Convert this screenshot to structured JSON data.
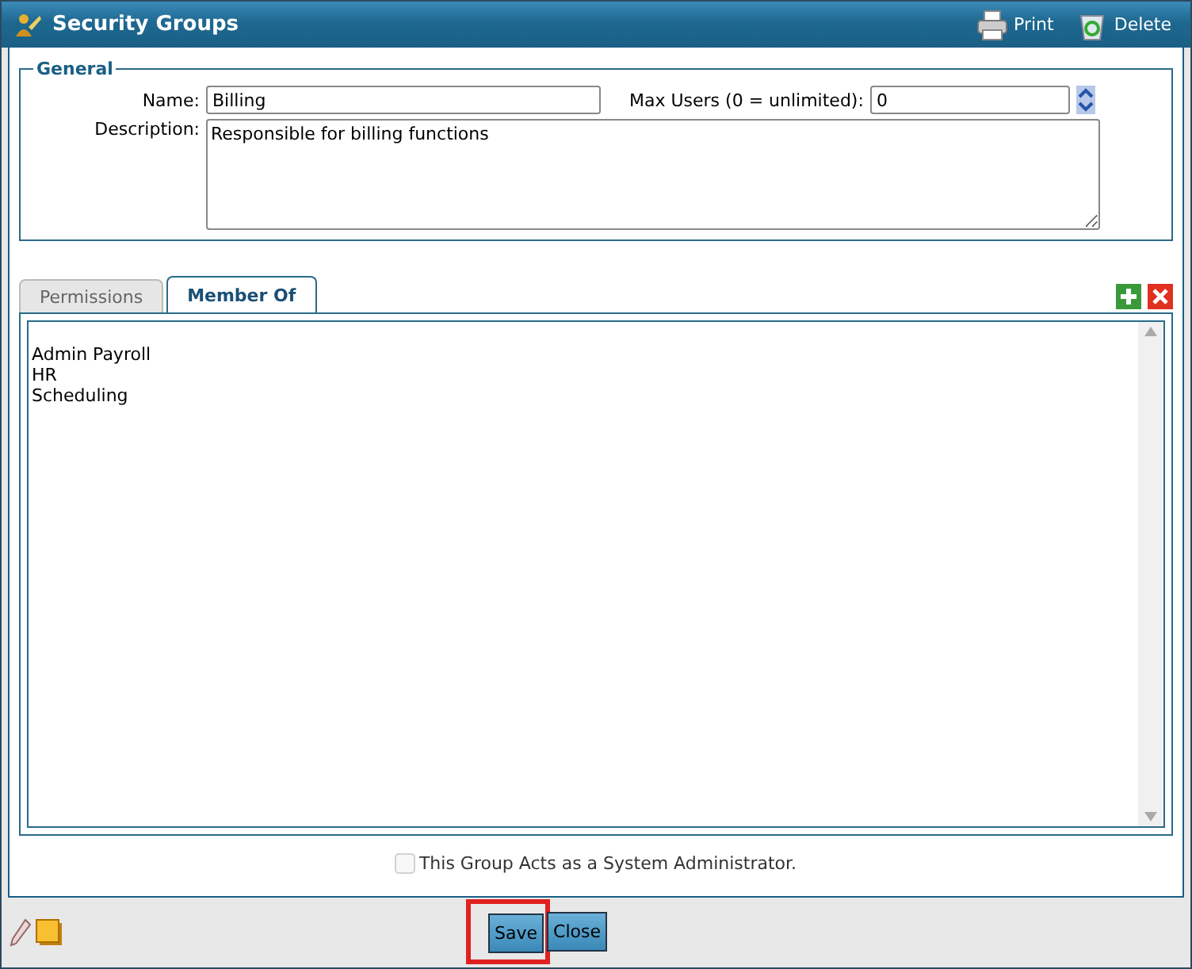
{
  "window": {
    "title": "Security Groups"
  },
  "toolbar": [
    {
      "label": "Print",
      "kind": "print"
    },
    {
      "label": "Delete",
      "kind": "delete"
    }
  ],
  "general": {
    "legend": "General",
    "name_label": "Name:",
    "name_value": "Billing",
    "max_users_label": "Max Users (0 = unlimited):",
    "max_users_value": "0",
    "description_label": "Description:",
    "description_value": "Responsible for billing functions"
  },
  "tabs": [
    {
      "label": "Permissions",
      "selected": false
    },
    {
      "label": "Member Of",
      "selected": true
    }
  ],
  "members": [
    "Admin Payroll",
    "HR",
    "Scheduling"
  ],
  "system_admin": {
    "label": "This Group Acts as a System Administrator.",
    "checked": false,
    "disabled": true
  },
  "buttons": [
    {
      "label": "Save",
      "highlighted": true
    },
    {
      "label": "Close",
      "highlighted": false
    }
  ]
}
